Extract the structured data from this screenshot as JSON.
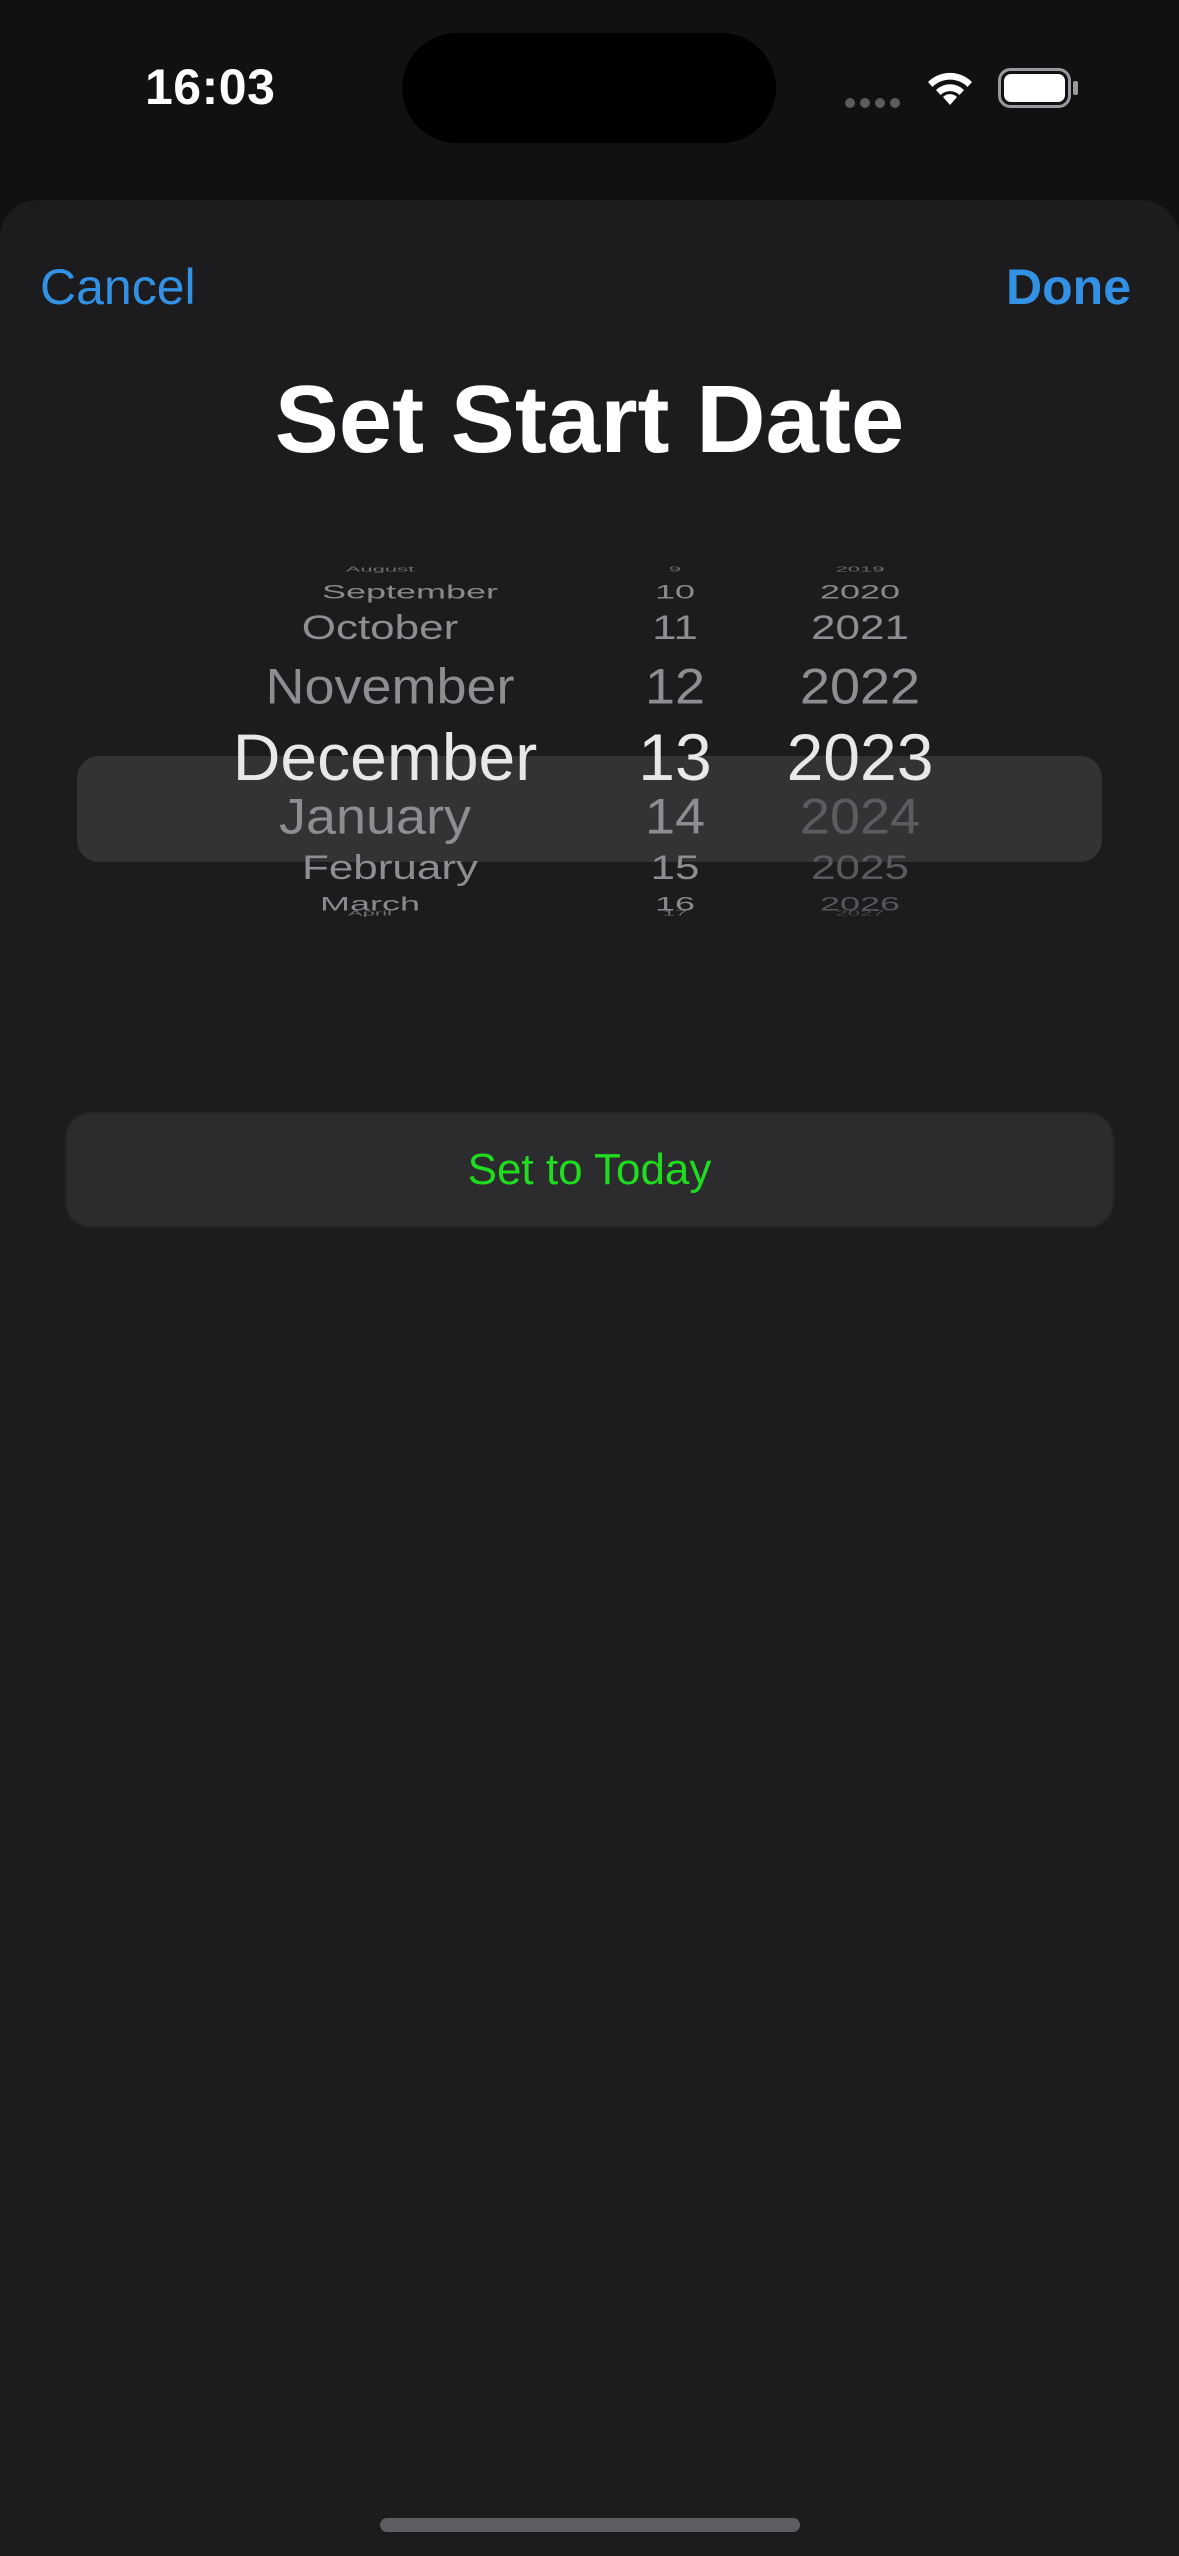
{
  "status_bar": {
    "time": "16:03",
    "icons": [
      "cellular-dots-icon",
      "wifi-icon",
      "battery-icon"
    ]
  },
  "sheet": {
    "cancel_label": "Cancel",
    "done_label": "Done",
    "title": "Set Start Date",
    "today_button_label": "Set to Today"
  },
  "picker": {
    "selected": {
      "month": "December",
      "day": "13",
      "year": "2023"
    },
    "months": [
      "August",
      "September",
      "October",
      "November",
      "December",
      "January",
      "February",
      "March",
      "April"
    ],
    "days": [
      "9",
      "10",
      "11",
      "12",
      "13",
      "14",
      "15",
      "16",
      "17"
    ],
    "years": [
      "2019",
      "2020",
      "2021",
      "2022",
      "2023",
      "2024",
      "2025",
      "2026",
      "2027"
    ]
  },
  "colors": {
    "accent_blue": "#3291e2",
    "today_green": "#1fdc1f",
    "sheet_background": "#1c1c1e",
    "highlight": "#333336"
  }
}
